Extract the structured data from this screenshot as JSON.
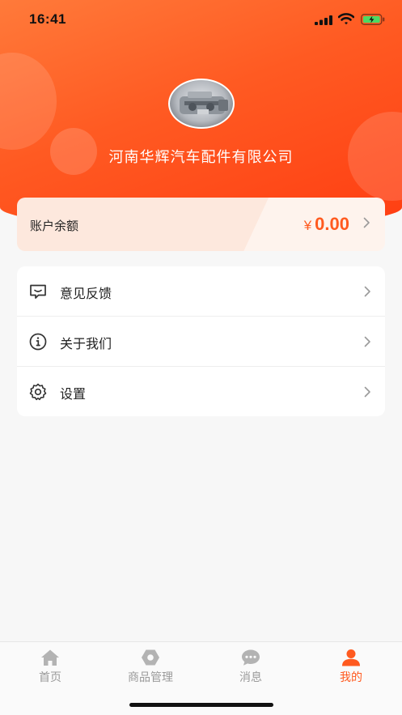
{
  "status_bar": {
    "time": "16:41"
  },
  "profile": {
    "company_name": "河南华辉汽车配件有限公司"
  },
  "balance": {
    "label": "账户余额",
    "currency": "¥",
    "amount": "0.00"
  },
  "menu": {
    "items": [
      {
        "label": "意见反馈",
        "icon": "feedback-icon"
      },
      {
        "label": "关于我们",
        "icon": "info-icon"
      },
      {
        "label": "设置",
        "icon": "settings-icon"
      }
    ]
  },
  "tabbar": {
    "active_index": 3,
    "tabs": [
      {
        "label": "首页",
        "icon": "home-icon"
      },
      {
        "label": "商品管理",
        "icon": "product-icon"
      },
      {
        "label": "消息",
        "icon": "message-icon"
      },
      {
        "label": "我的",
        "icon": "user-icon"
      }
    ]
  },
  "colors": {
    "accent": "#ff5a1f",
    "header_start": "#ff7a3a",
    "header_end": "#ff3e12"
  }
}
